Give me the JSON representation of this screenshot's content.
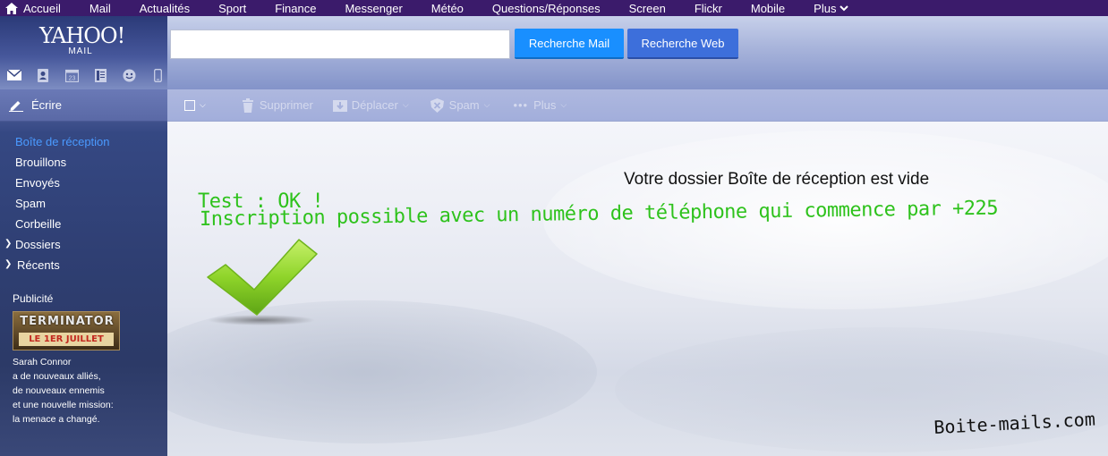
{
  "topnav": {
    "items": [
      "Accueil",
      "Mail",
      "Actualités",
      "Sport",
      "Finance",
      "Messenger",
      "Météo",
      "Questions/Réponses",
      "Screen",
      "Flickr",
      "Mobile",
      "Plus"
    ]
  },
  "logo": {
    "line1": "YAHOO!",
    "line2": "MAIL"
  },
  "search": {
    "value": "",
    "mail_button": "Recherche Mail",
    "web_button": "Recherche Web"
  },
  "apps": [
    "mail-icon",
    "contacts-icon",
    "calendar-icon",
    "notepad-icon",
    "messenger-icon",
    "mobile-icon"
  ],
  "sidebar": {
    "compose_label": "Écrire",
    "folders": [
      "Boîte de réception",
      "Brouillons",
      "Envoyés",
      "Spam",
      "Corbeille"
    ],
    "groups": [
      "Dossiers",
      "Récents"
    ],
    "ad": {
      "label": "Publicité",
      "title": "TERMINATOR",
      "subtitle": "LE 1ER JUILLET",
      "lines": [
        "Sarah Connor",
        "a de nouveaux alliés,",
        "de nouveaux ennemis",
        "et une nouvelle mission:",
        "la menace a changé."
      ]
    }
  },
  "toolbar": {
    "delete": "Supprimer",
    "move": "Déplacer",
    "spam": "Spam",
    "more": "Plus"
  },
  "main": {
    "empty_message": "Votre dossier Boîte de réception est vide",
    "annotation_line1": "Test : OK !",
    "annotation_line2": "Inscription possible avec un numéro de téléphone qui commence par +225",
    "watermark": "Boite-mails.com"
  },
  "colors": {
    "nav_bg": "#3b1b6b",
    "accent_blue": "#198fff",
    "annotation_green": "#2ec21c"
  }
}
